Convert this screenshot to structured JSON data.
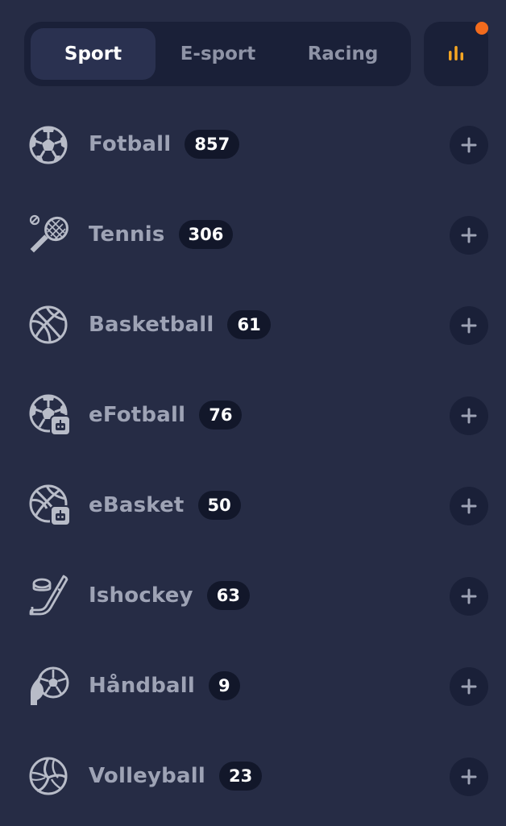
{
  "tabs": [
    {
      "label": "Sport",
      "active": true
    },
    {
      "label": "E-sport",
      "active": false
    },
    {
      "label": "Racing",
      "active": false
    }
  ],
  "stats_button": {
    "icon": "bar-chart-icon",
    "notification_dot": true,
    "accent": "#f5a623",
    "dot_color": "#f26b1d"
  },
  "sports": [
    {
      "name": "Fotball",
      "count": "857",
      "icon": "soccer-ball-icon"
    },
    {
      "name": "Tennis",
      "count": "306",
      "icon": "tennis-racket-icon"
    },
    {
      "name": "Basketball",
      "count": "61",
      "icon": "basketball-icon"
    },
    {
      "name": "eFotball",
      "count": "76",
      "icon": "esoccer-icon"
    },
    {
      "name": "eBasket",
      "count": "50",
      "icon": "ebasketball-icon"
    },
    {
      "name": "Ishockey",
      "count": "63",
      "icon": "ice-hockey-icon"
    },
    {
      "name": "Håndball",
      "count": "9",
      "icon": "handball-icon"
    },
    {
      "name": "Volleyball",
      "count": "23",
      "icon": "volleyball-icon"
    }
  ],
  "colors": {
    "background": "#262c45",
    "panel": "#1a2038",
    "badge": "#12172a",
    "text_muted": "#9ea3b5",
    "text_active": "#ffffff"
  }
}
